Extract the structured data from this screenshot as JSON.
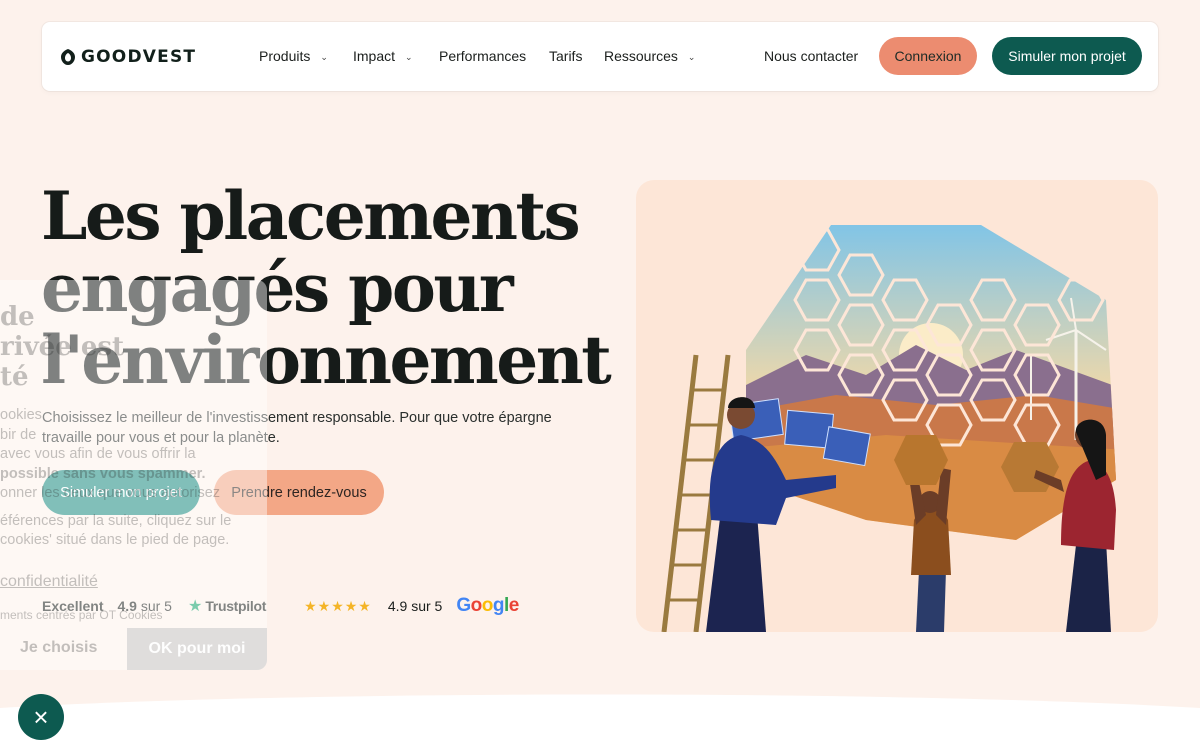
{
  "nav": {
    "brand": "GOODVEST",
    "items": [
      {
        "label": "Produits",
        "has_dropdown": true
      },
      {
        "label": "Impact",
        "has_dropdown": true
      },
      {
        "label": "Performances",
        "has_dropdown": false
      },
      {
        "label": "Tarifs",
        "has_dropdown": false
      },
      {
        "label": "Ressources",
        "has_dropdown": true
      }
    ],
    "contact": "Nous contacter",
    "login": "Connexion",
    "simulate": "Simuler mon projet",
    "chevron": "›"
  },
  "hero": {
    "title_line1": "Les placements",
    "title_line2": "engagés pour",
    "title_line3": "l'environnement",
    "subtitle": "Choisissez le meilleur de l'investissement responsable. Pour que votre épargne travaille pour vous et pour la planète.",
    "cta_primary": "Simuler mon projet",
    "cta_secondary": "Prendre rendez-vous"
  },
  "ratings": {
    "trustpilot_label": "Excellent",
    "trustpilot_score": "4.9",
    "trustpilot_suffix": "sur 5",
    "trustpilot_brand": "Trustpilot",
    "google_stars": "★★★★★",
    "google_score": "4.9 sur 5",
    "google_brand": "Google"
  },
  "cookie_banner": {
    "title_l1": "de",
    "title_l2": "rivée est",
    "title_l3": "té",
    "body_l1": "ookies",
    "body_l2": "bir de",
    "body_l3": "avec vous afin de vous offrir la",
    "body_l4": "possible sans vous spammer.",
    "body_l5": "onner les ceux que vous autorisez",
    "body_l6": "éférences par la suite, cliquez sur le",
    "body_l7": "cookies' situé dans le pied de page.",
    "link": "confidentialité",
    "small": "ments centrés par OT Cookies",
    "choose": "Je choisis",
    "ok": "OK pour moi"
  },
  "close_icon": "×",
  "colors": {
    "background": "#fdf2ec",
    "brand_dark_green": "#0d5a50",
    "teal": "#1a8a80",
    "coral": "#ec8c70",
    "peach": "#f3a786",
    "star_gold": "#f4b427",
    "trustpilot_green": "#10a36b"
  }
}
